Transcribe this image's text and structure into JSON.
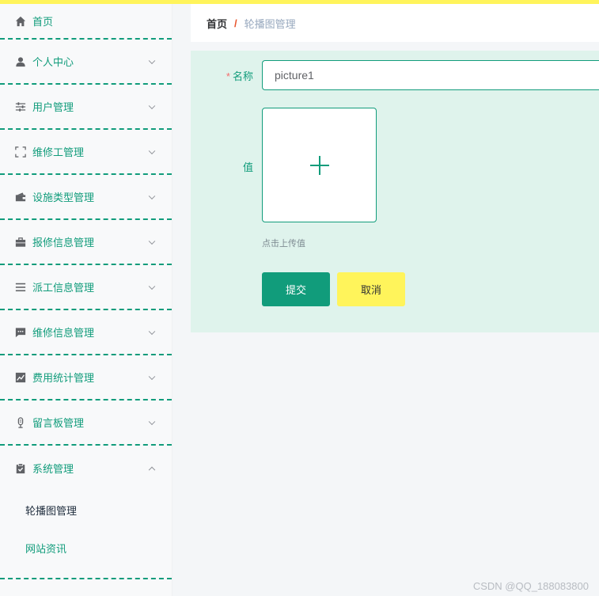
{
  "sidebar": {
    "items": [
      {
        "label": "首页",
        "icon": "home-icon"
      },
      {
        "label": "个人中心",
        "icon": "user-icon"
      },
      {
        "label": "用户管理",
        "icon": "sliders-icon"
      },
      {
        "label": "维修工管理",
        "icon": "fullscreen-icon"
      },
      {
        "label": "设施类型管理",
        "icon": "wallet-icon"
      },
      {
        "label": "报修信息管理",
        "icon": "briefcase-icon"
      },
      {
        "label": "派工信息管理",
        "icon": "menu-icon"
      },
      {
        "label": "维修信息管理",
        "icon": "message-icon"
      },
      {
        "label": "费用统计管理",
        "icon": "chart-icon"
      },
      {
        "label": "留言板管理",
        "icon": "microphone-icon"
      },
      {
        "label": "系统管理",
        "icon": "clipboard-icon"
      }
    ],
    "system_submenu": [
      {
        "label": "轮播图管理"
      },
      {
        "label": "网站资讯"
      }
    ]
  },
  "breadcrumb": {
    "home": "首页",
    "separator": "/",
    "current": "轮播图管理"
  },
  "form": {
    "name_required_mark": "*",
    "name_label": "名称",
    "name_value": "picture1",
    "value_label": "值",
    "upload_tip": "点击上传值",
    "submit_label": "提交",
    "cancel_label": "取消"
  },
  "watermark": "CSDN @QQ_188083800",
  "colors": {
    "accent": "#119c7b",
    "highlight": "#fff45b",
    "panel": "#dff3ec"
  }
}
